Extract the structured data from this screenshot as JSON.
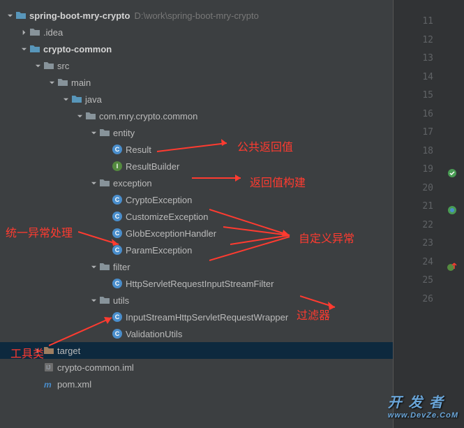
{
  "root": {
    "name": "spring-boot-mry-crypto",
    "path": "D:\\work\\spring-boot-mry-crypto"
  },
  "tree": {
    "idea": ".idea",
    "cryptoCommon": "crypto-common",
    "src": "src",
    "main": "main",
    "java": "java",
    "package": "com.mry.crypto.common",
    "entity": "entity",
    "result": "Result",
    "resultBuilder": "ResultBuilder",
    "exception": "exception",
    "cryptoException": "CryptoException",
    "customizeException": "CustomizeException",
    "globExceptionHandler": "GlobExceptionHandler",
    "paramException": "ParamException",
    "filter": "filter",
    "httpFilter": "HttpServletRequestInputStreamFilter",
    "utils": "utils",
    "inputStreamWrapper": "InputStreamHttpServletRequestWrapper",
    "validationUtils": "ValidationUtils",
    "target": "target",
    "iml": "crypto-common.iml",
    "pom": "pom.xml"
  },
  "annotations": {
    "publicReturn": "公共返回值",
    "returnBuilder": "返回值构建",
    "unifiedException": "统一异常处理",
    "customException": "自定义异常",
    "filterAnno": "过滤器",
    "utilClass": "工具类"
  },
  "lineNumbers": [
    "11",
    "12",
    "13",
    "14",
    "15",
    "16",
    "17",
    "18",
    "19",
    "20",
    "21",
    "22",
    "23",
    "24",
    "25",
    "26"
  ],
  "watermark": {
    "main": "开 发 者",
    "sub": "www.DevZe.CoM"
  }
}
